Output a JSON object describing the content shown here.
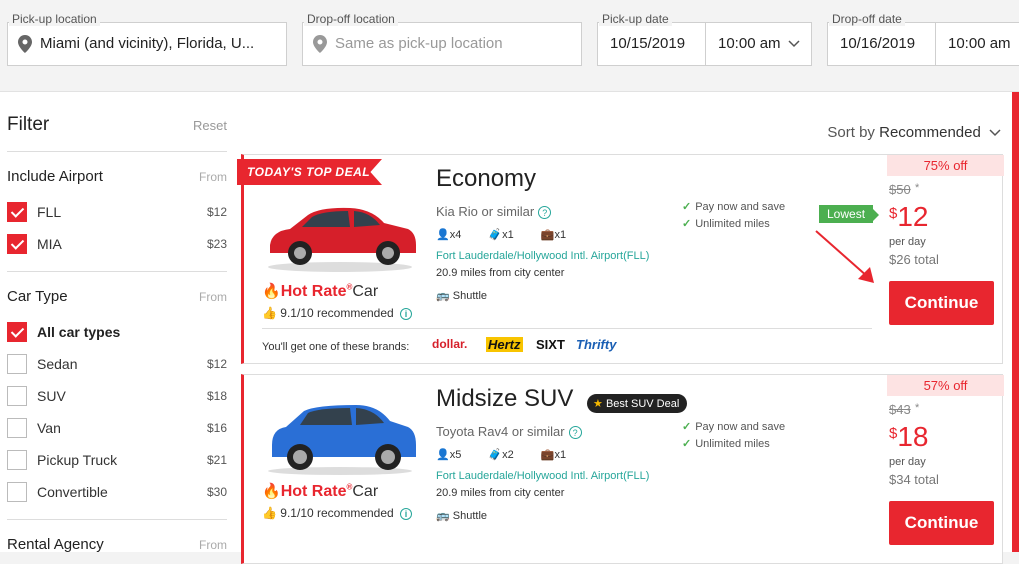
{
  "search": {
    "pickup_location": {
      "label": "Pick-up location",
      "value": "Miami (and vicinity), Florida, U..."
    },
    "dropoff_location": {
      "label": "Drop-off location",
      "placeholder": "Same as pick-up location"
    },
    "pickup_date": {
      "label": "Pick-up date",
      "date": "10/15/2019",
      "time": "10:00 am"
    },
    "dropoff_date": {
      "label": "Drop-off date",
      "date": "10/16/2019",
      "time": "10:00 am"
    }
  },
  "filter": {
    "title": "Filter",
    "reset_label": "Reset",
    "include_airport": {
      "title": "Include Airport",
      "from_label": "From",
      "items": [
        {
          "label": "FLL",
          "price": "$12",
          "checked": true
        },
        {
          "label": "MIA",
          "price": "$23",
          "checked": true
        }
      ]
    },
    "car_type": {
      "title": "Car Type",
      "from_label": "From",
      "items": [
        {
          "label": "All car types",
          "price": "",
          "checked": true
        },
        {
          "label": "Sedan",
          "price": "$12",
          "checked": false
        },
        {
          "label": "SUV",
          "price": "$18",
          "checked": false
        },
        {
          "label": "Van",
          "price": "$16",
          "checked": false
        },
        {
          "label": "Pickup Truck",
          "price": "$21",
          "checked": false
        },
        {
          "label": "Convertible",
          "price": "$30",
          "checked": false
        }
      ]
    },
    "rental_agency": {
      "title": "Rental Agency",
      "from_label": "From"
    }
  },
  "sort": {
    "prefix": "Sort by",
    "value": "Recommended"
  },
  "listings": [
    {
      "ribbon": "TODAY'S TOP DEAL",
      "car_class": "Economy",
      "model": "Kia Rio or similar",
      "passengers": "x4",
      "large_bags": "x1",
      "small_bags": "x1",
      "airport": "Fort Lauderdale/Hollywood Intl. Airport(FLL)",
      "distance": "20.9 miles from city center",
      "shuttle": "Shuttle",
      "features": [
        "Pay now and save",
        "Unlimited miles"
      ],
      "hotrate": {
        "hot": "Hot Rate",
        "reg": "®",
        "car": "Car"
      },
      "recommended": "9.1/10 recommended",
      "brands_label": "You'll get one of these brands:",
      "brands": [
        "dollar.",
        "Hertz",
        "SIXT",
        "Thrifty"
      ],
      "discount": "75% off",
      "old_price": "$50",
      "old_price_mark": "*",
      "currency": "$",
      "price": "12",
      "per_day": "per day",
      "total": "$26 total",
      "continue_label": "Continue",
      "lowest_label": "Lowest",
      "car_color": "#d61f2a"
    },
    {
      "deal_badge": "Best SUV Deal",
      "car_class": "Midsize SUV",
      "model": "Toyota Rav4 or similar",
      "passengers": "x5",
      "large_bags": "x2",
      "small_bags": "x1",
      "airport": "Fort Lauderdale/Hollywood Intl. Airport(FLL)",
      "distance": "20.9 miles from city center",
      "shuttle": "Shuttle",
      "features": [
        "Pay now and save",
        "Unlimited miles"
      ],
      "hotrate": {
        "hot": "Hot Rate",
        "reg": "®",
        "car": "Car"
      },
      "recommended": "9.1/10 recommended",
      "discount": "57% off",
      "old_price": "$43",
      "old_price_mark": "*",
      "currency": "$",
      "price": "18",
      "per_day": "per day",
      "total": "$34 total",
      "continue_label": "Continue",
      "car_color": "#2a6fd6"
    }
  ]
}
